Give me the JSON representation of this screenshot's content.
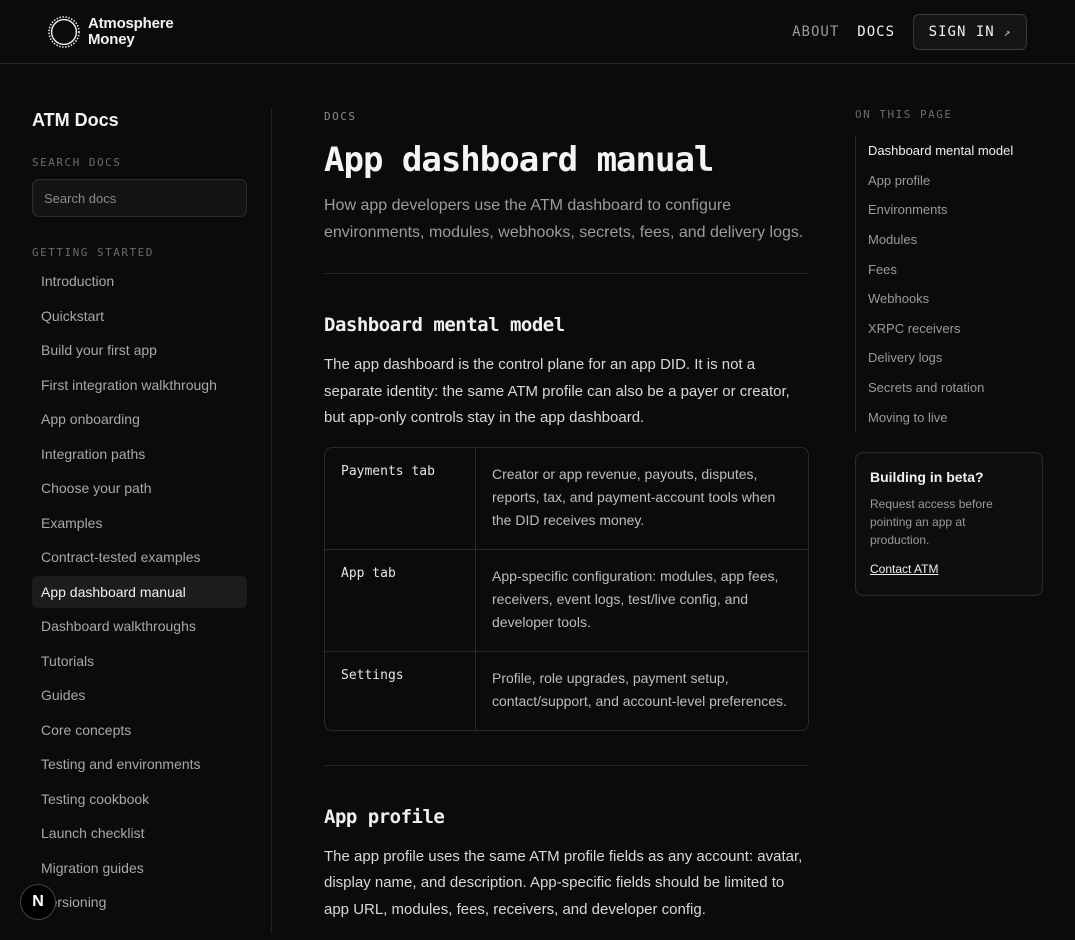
{
  "brand": {
    "line1": "Atmosphere",
    "line2": "Money"
  },
  "nav": {
    "about": "ABOUT",
    "docs": "DOCS",
    "signin": "SIGN IN",
    "signin_arrow": "↗"
  },
  "sidebar": {
    "title": "ATM Docs",
    "search_label": "SEARCH DOCS",
    "search_placeholder": "Search docs",
    "group_label": "GETTING STARTED",
    "items": [
      {
        "label": "Introduction"
      },
      {
        "label": "Quickstart"
      },
      {
        "label": "Build your first app"
      },
      {
        "label": "First integration walkthrough"
      },
      {
        "label": "App onboarding"
      },
      {
        "label": "Integration paths"
      },
      {
        "label": "Choose your path"
      },
      {
        "label": "Examples"
      },
      {
        "label": "Contract-tested examples"
      },
      {
        "label": "App dashboard manual",
        "active": true
      },
      {
        "label": "Dashboard walkthroughs"
      },
      {
        "label": "Tutorials"
      },
      {
        "label": "Guides"
      },
      {
        "label": "Core concepts"
      },
      {
        "label": "Testing and environments"
      },
      {
        "label": "Testing cookbook"
      },
      {
        "label": "Launch checklist"
      },
      {
        "label": "Migration guides"
      },
      {
        "label": "Versioning"
      }
    ]
  },
  "main": {
    "crumb": "DOCS",
    "title": "App dashboard manual",
    "lede": "How app developers use the ATM dashboard to configure environments, modules, webhooks, secrets, fees, and delivery logs.",
    "section1": {
      "heading": "Dashboard mental model",
      "body": "The app dashboard is the control plane for an app DID. It is not a separate identity: the same ATM profile can also be a payer or creator, but app-only controls stay in the app dashboard.",
      "rows": [
        {
          "key": "Payments tab",
          "value": "Creator or app revenue, payouts, disputes, reports, tax, and payment-account tools when the DID receives money."
        },
        {
          "key": "App tab",
          "value": "App-specific configuration: modules, app fees, receivers, event logs, test/live config, and developer tools."
        },
        {
          "key": "Settings",
          "value": "Profile, role upgrades, payment setup, contact/support, and account-level preferences."
        }
      ]
    },
    "section2": {
      "heading": "App profile",
      "body": "The app profile uses the same ATM profile fields as any account: avatar, display name, and description. App-specific fields should be limited to app URL, modules, fees, receivers, and developer config."
    }
  },
  "toc": {
    "label": "ON THIS PAGE",
    "items": [
      {
        "label": "Dashboard mental model",
        "active": true
      },
      {
        "label": "App profile"
      },
      {
        "label": "Environments"
      },
      {
        "label": "Modules"
      },
      {
        "label": "Fees"
      },
      {
        "label": "Webhooks"
      },
      {
        "label": "XRPC receivers"
      },
      {
        "label": "Delivery logs"
      },
      {
        "label": "Secrets and rotation"
      },
      {
        "label": "Moving to live"
      }
    ]
  },
  "beta": {
    "title": "Building in beta?",
    "body": "Request access before pointing an app at production.",
    "link": "Contact ATM"
  },
  "badge": {
    "letter": "N"
  }
}
